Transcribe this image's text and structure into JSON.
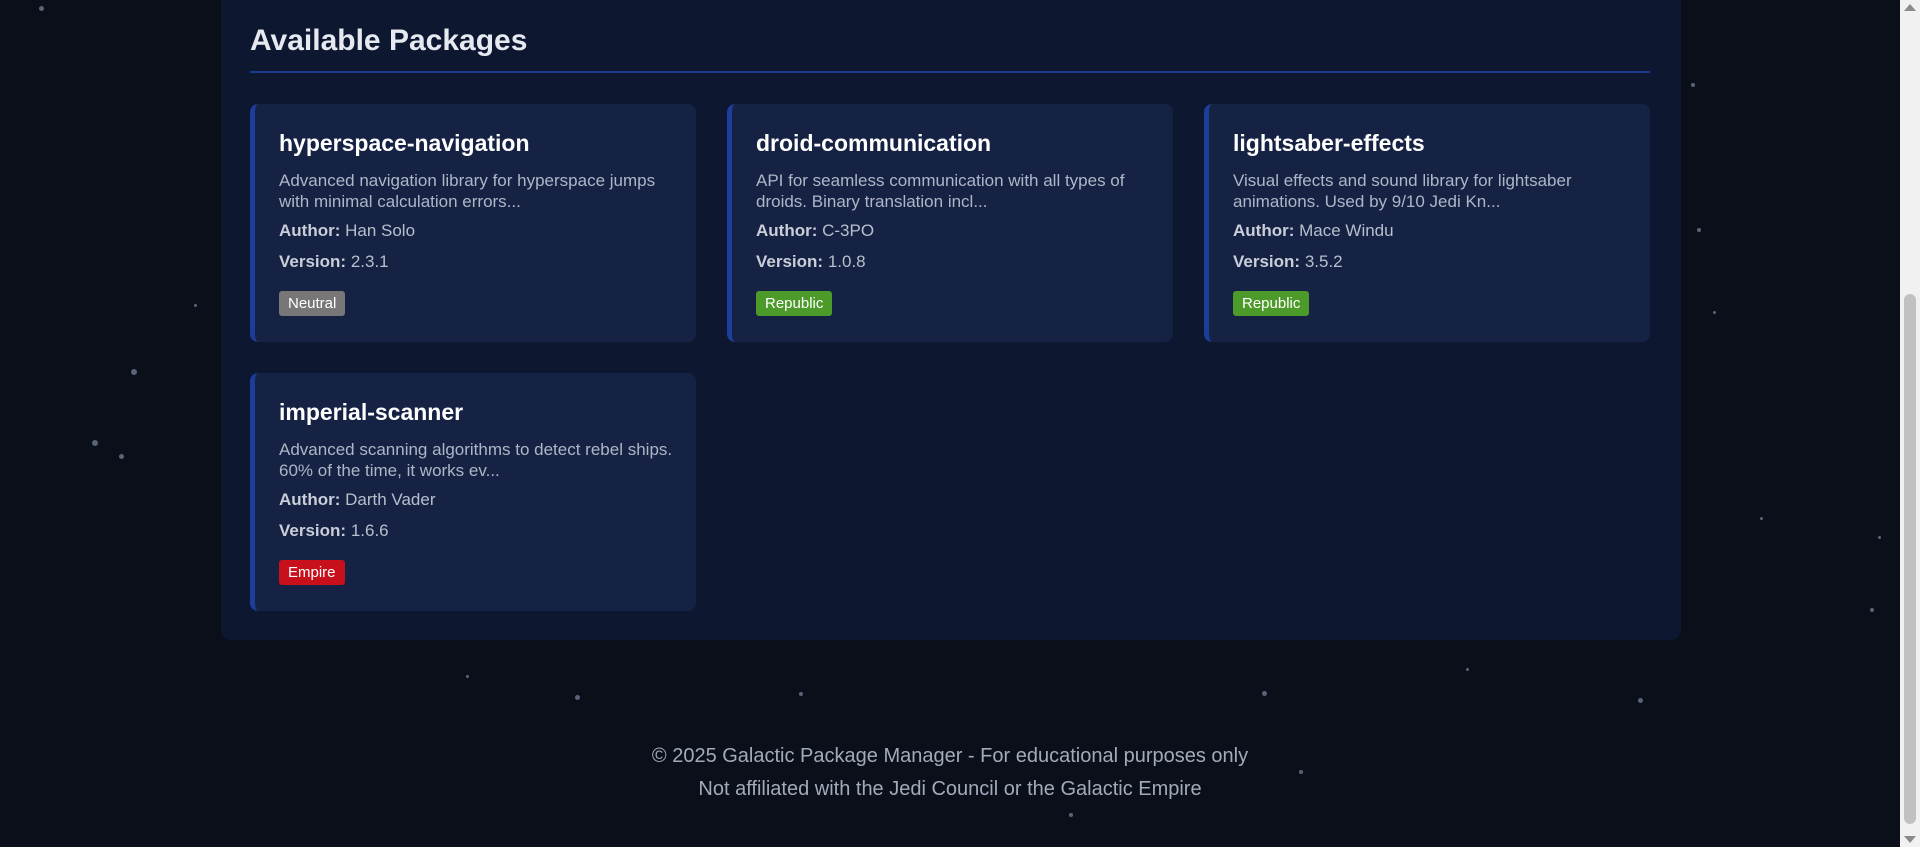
{
  "section": {
    "title": "Available Packages"
  },
  "packages": [
    {
      "name": "hyperspace-navigation",
      "description": "Advanced navigation library for hyperspace jumps with minimal calculation errors...",
      "author_label": "Author:",
      "author": "Han Solo",
      "version_label": "Version:",
      "version": "2.3.1",
      "faction": "Neutral"
    },
    {
      "name": "droid-communication",
      "description": "API for seamless communication with all types of droids. Binary translation incl...",
      "author_label": "Author:",
      "author": "C-3PO",
      "version_label": "Version:",
      "version": "1.0.8",
      "faction": "Republic"
    },
    {
      "name": "lightsaber-effects",
      "description": "Visual effects and sound library for lightsaber animations. Used by 9/10 Jedi Kn...",
      "author_label": "Author:",
      "author": "Mace Windu",
      "version_label": "Version:",
      "version": "3.5.2",
      "faction": "Republic"
    },
    {
      "name": "imperial-scanner",
      "description": "Advanced scanning algorithms to detect rebel ships. 60% of the time, it works ev...",
      "author_label": "Author:",
      "author": "Darth Vader",
      "version_label": "Version:",
      "version": "1.6.6",
      "faction": "Empire"
    }
  ],
  "faction_colors": {
    "Neutral": "#777777",
    "Republic": "#4c9a2a",
    "Empire": "#c8101c"
  },
  "footer": {
    "line1": "© 2025 Galactic Package Manager - For educational purposes only",
    "line2": "Not affiliated with the Jedi Council or the Galactic Empire"
  },
  "icons": {
    "scroll_up": "triangle-up-icon",
    "scroll_down": "triangle-down-icon"
  }
}
